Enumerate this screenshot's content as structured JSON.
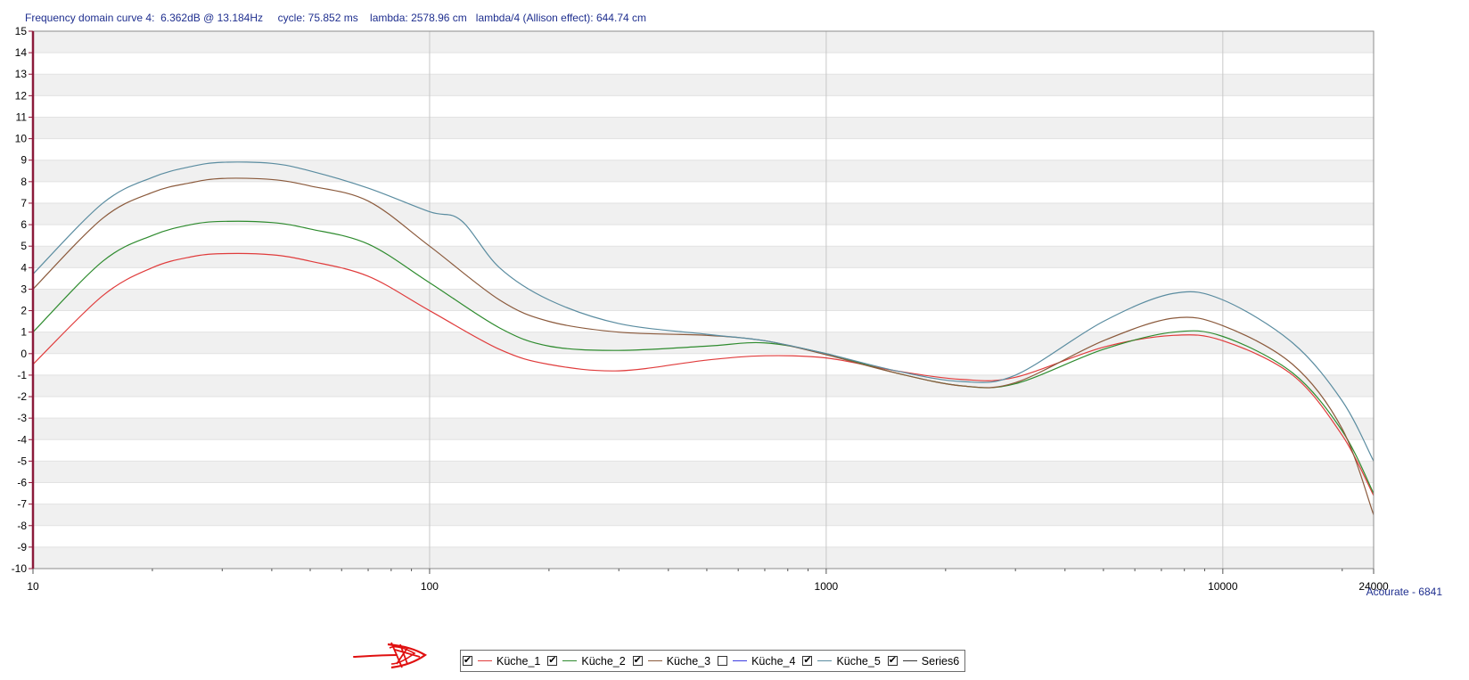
{
  "status": {
    "text": "Frequency domain curve 4:  6.362dB @ 13.184Hz     cycle: 75.852 ms    lambda: 2578.96 cm   lambda/4 (Allison effect): 644.74 cm"
  },
  "watermark": "Acourate - 6841",
  "colors": {
    "grid_major": "#c8c8c8",
    "band": "#f0f0f0",
    "axis": "#8b1a3a",
    "border": "#8c8c8c"
  },
  "chart_data": {
    "type": "line",
    "x_scale": "log",
    "xlim": [
      10,
      24000
    ],
    "ylim": [
      -10,
      15
    ],
    "x_ticks": [
      10,
      100,
      1000,
      10000,
      24000
    ],
    "x_tick_labels": [
      "10",
      "100",
      "1000",
      "10000",
      "24000"
    ],
    "y_ticks": [
      15,
      14,
      13,
      12,
      11,
      10,
      9,
      8,
      7,
      6,
      5,
      4,
      3,
      2,
      1,
      0,
      -1,
      -2,
      -3,
      -4,
      -5,
      -6,
      -7,
      -8,
      -9,
      -10
    ],
    "grid": true,
    "legend_position": "bottom",
    "series": [
      {
        "name": "Küche_1",
        "color": "#e03c3c",
        "checked": true,
        "x": [
          10,
          15,
          20,
          25,
          30,
          40,
          50,
          70,
          100,
          150,
          200,
          300,
          500,
          700,
          1000,
          1500,
          2200,
          3000,
          5000,
          7500,
          10000,
          15000,
          20000,
          24000
        ],
        "y": [
          -0.5,
          2.7,
          4.0,
          4.5,
          4.65,
          4.6,
          4.3,
          3.6,
          2.0,
          0.2,
          -0.5,
          -0.8,
          -0.3,
          -0.1,
          -0.2,
          -0.8,
          -1.2,
          -1.1,
          0.3,
          0.85,
          0.6,
          -1.0,
          -3.8,
          -6.6
        ]
      },
      {
        "name": "Küche_2",
        "color": "#2e8b2e",
        "checked": true,
        "x": [
          10,
          15,
          20,
          25,
          30,
          40,
          50,
          70,
          100,
          150,
          200,
          300,
          500,
          700,
          1000,
          1500,
          2200,
          3000,
          5000,
          7500,
          10000,
          15000,
          20000,
          24000
        ],
        "y": [
          1.0,
          4.3,
          5.5,
          6.0,
          6.15,
          6.1,
          5.8,
          5.1,
          3.3,
          1.2,
          0.35,
          0.15,
          0.35,
          0.5,
          0.0,
          -0.9,
          -1.5,
          -1.4,
          0.2,
          1.0,
          0.8,
          -0.9,
          -3.6,
          -6.5
        ]
      },
      {
        "name": "Küche_3",
        "color": "#8b5a3c",
        "checked": true,
        "x": [
          10,
          15,
          20,
          25,
          30,
          40,
          50,
          70,
          100,
          150,
          200,
          300,
          500,
          700,
          1000,
          1500,
          2200,
          3000,
          5000,
          7500,
          10000,
          15000,
          20000,
          24000
        ],
        "y": [
          3.0,
          6.3,
          7.5,
          7.95,
          8.15,
          8.1,
          7.8,
          7.1,
          5.0,
          2.5,
          1.5,
          1.0,
          0.85,
          0.6,
          -0.05,
          -0.9,
          -1.5,
          -1.35,
          0.6,
          1.65,
          1.3,
          -0.5,
          -3.5,
          -7.5
        ]
      },
      {
        "name": "Küche_4",
        "color": "#3c3ce0",
        "checked": false,
        "x": [],
        "y": []
      },
      {
        "name": "Küche_5",
        "color": "#5a8ca0",
        "checked": true,
        "x": [
          10,
          15,
          20,
          25,
          30,
          40,
          50,
          70,
          100,
          120,
          150,
          200,
          300,
          500,
          700,
          1000,
          1500,
          2200,
          3000,
          5000,
          7500,
          10000,
          15000,
          20000,
          24000
        ],
        "y": [
          3.7,
          7.0,
          8.2,
          8.7,
          8.9,
          8.85,
          8.5,
          7.7,
          6.6,
          6.2,
          4.0,
          2.5,
          1.4,
          0.9,
          0.6,
          0.0,
          -0.8,
          -1.3,
          -1.0,
          1.5,
          2.8,
          2.5,
          0.5,
          -2.2,
          -5.0
        ]
      },
      {
        "name": "Series6",
        "color": "#333333",
        "checked": true,
        "x": [],
        "y": []
      }
    ]
  }
}
